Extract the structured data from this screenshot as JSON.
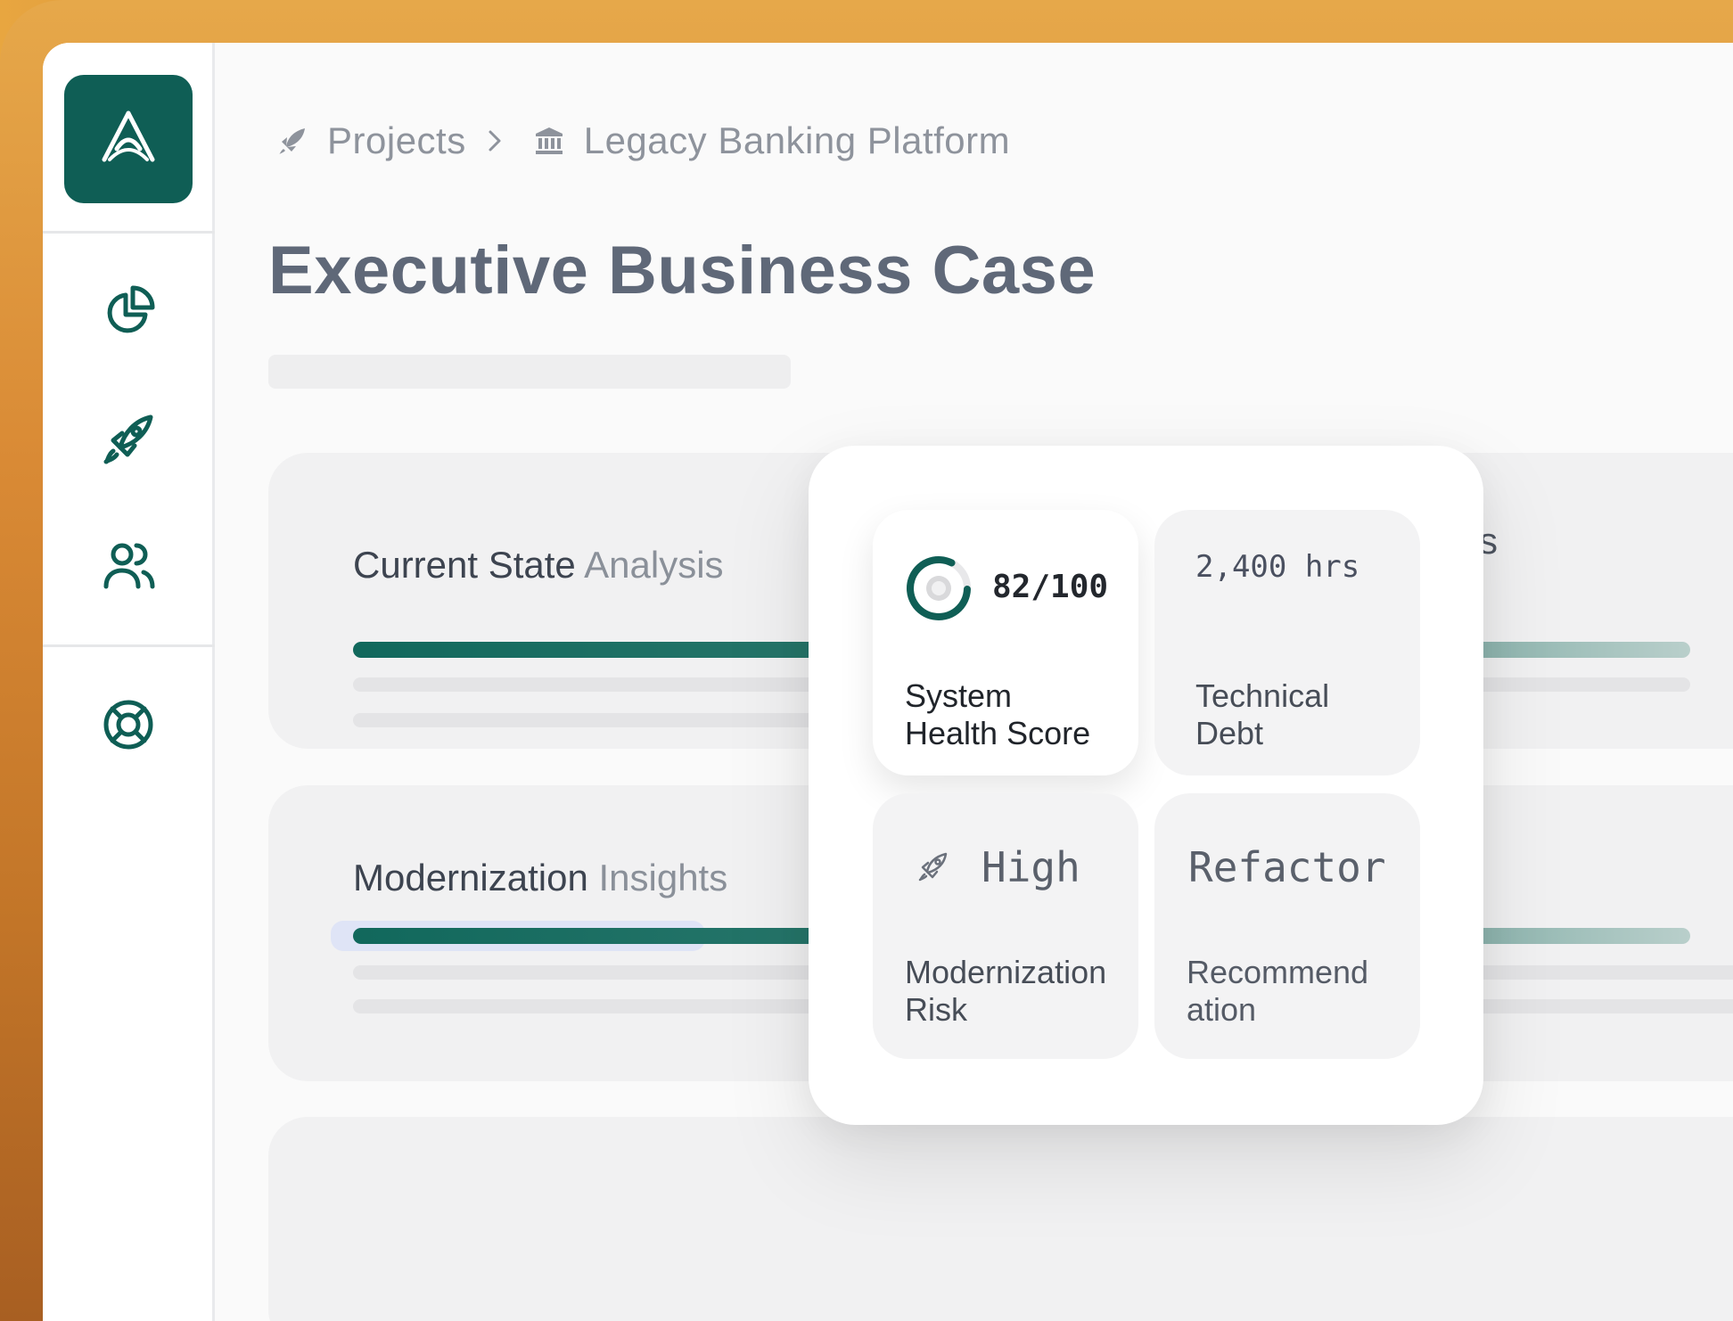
{
  "breadcrumb": {
    "items": [
      {
        "label": "Projects",
        "icon": "rocket-icon"
      },
      {
        "label": "Legacy Banking Platform",
        "icon": "bank-icon"
      }
    ]
  },
  "page": {
    "title": "Executive Business Case"
  },
  "sidebar": {
    "items": [
      {
        "icon": "pie-chart-icon"
      },
      {
        "icon": "rocket-icon"
      },
      {
        "icon": "users-icon"
      },
      {
        "icon": "lifebuoy-icon"
      }
    ]
  },
  "cards": [
    {
      "title_main": "Current State",
      "title_fade": " Analysis"
    },
    {
      "title_main": "Modernization",
      "title_fade": " Insights"
    }
  ],
  "partial_text": "s",
  "metrics": {
    "health": {
      "value": "82/100",
      "label": "System\nHealth Score",
      "score": 82,
      "max": 100
    },
    "debt": {
      "value": "2,400 hrs",
      "label": "Technical\nDebt"
    },
    "risk": {
      "value": "High",
      "label": "Modernization\nRisk",
      "icon": "rocket-icon"
    },
    "recommendation": {
      "value": "Refactor",
      "label": "Recommend\nation"
    }
  },
  "colors": {
    "brand": "#0f5e55",
    "accent": "#11685c"
  }
}
